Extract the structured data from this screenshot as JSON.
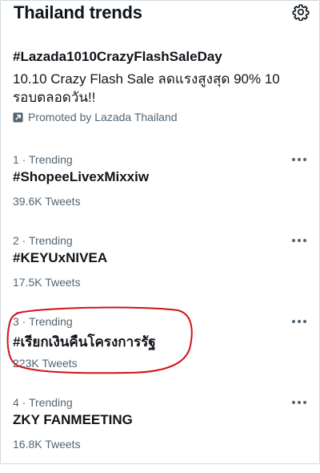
{
  "header": {
    "title": "Thailand trends",
    "settings_icon": "gear-icon"
  },
  "promoted": {
    "hashtag": "#Lazada1010CrazyFlashSaleDay",
    "description": "10.10 Crazy Flash Sale ลดแรงสูงสุด 90% 10 รอบตลอดวัน!!",
    "promoted_by": "Promoted by Lazada Thailand",
    "icon": "promoted-arrow-icon"
  },
  "trends": [
    {
      "meta": "1 · Trending",
      "name": "#ShopeeLivexMixxiw",
      "count": "39.6K Tweets"
    },
    {
      "meta": "2 · Trending",
      "name": "#KEYUxNIVEA",
      "count": "17.5K Tweets"
    },
    {
      "meta": "3 · Trending",
      "name": "#เรียกเงินคืนโครงการรัฐ",
      "count": "223K Tweets"
    },
    {
      "meta": "4 · Trending",
      "name": "ZKY FANMEETING",
      "count": "16.8K Tweets"
    }
  ],
  "colors": {
    "text_primary": "#0f1419",
    "text_secondary": "#536471",
    "highlight_circle": "#d0121b"
  }
}
